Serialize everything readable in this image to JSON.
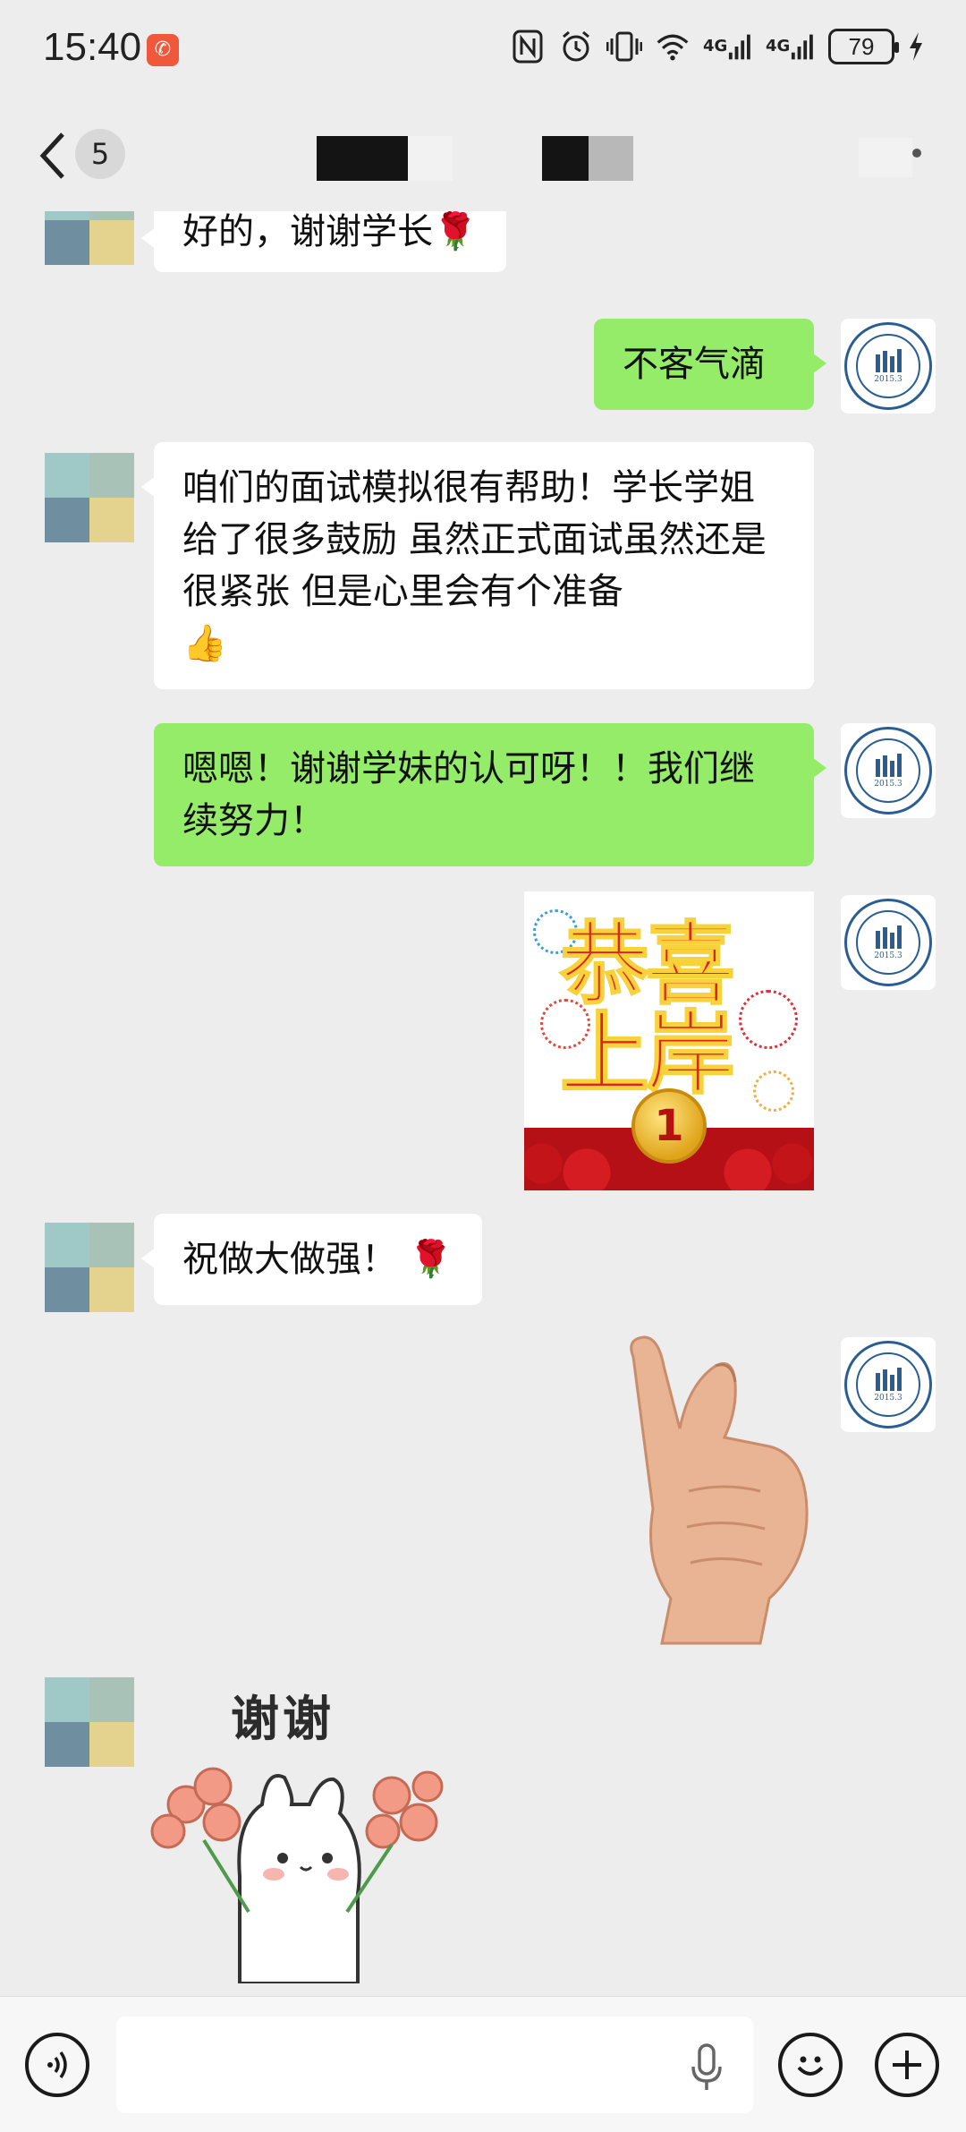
{
  "status_bar": {
    "time": "15:40",
    "network_1": "4G",
    "network_2": "4G",
    "battery": "79"
  },
  "header": {
    "unread_count": "5"
  },
  "messages": [
    {
      "side": "left",
      "text": "好的，谢谢学长",
      "emoji": "🌹"
    },
    {
      "side": "right",
      "text": "不客气滴"
    },
    {
      "side": "left",
      "text": "咱们的面试模拟很有帮助！学长学姐给了很多鼓励 虽然正式面试虽然还是很紧张 但是心里会有个准备",
      "emoji": "👍"
    },
    {
      "side": "right",
      "text": "嗯嗯！谢谢学妹的认可呀！！我们继续努力！"
    },
    {
      "side": "right",
      "sticker": "congrats",
      "line1": "恭喜",
      "line2": "上岸",
      "medal": "1"
    },
    {
      "side": "left",
      "text": "祝做大做强！",
      "emoji": "🌹"
    },
    {
      "side": "right",
      "sticker": "finger-heart"
    },
    {
      "side": "left",
      "sticker": "thanks-bunny",
      "caption": "谢谢"
    }
  ],
  "avatar_right": {
    "year": "2015.3",
    "color": "#2a5d93"
  },
  "colors": {
    "background": "#ededed",
    "bubble_green": "#95ec69",
    "bubble_white": "#ffffff"
  },
  "input": {
    "placeholder": ""
  }
}
